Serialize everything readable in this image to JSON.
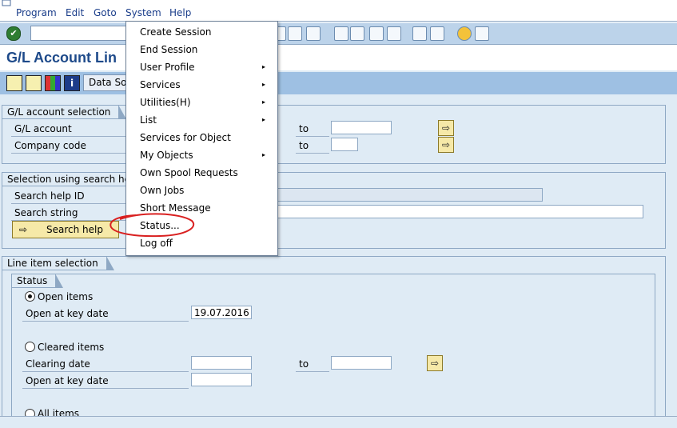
{
  "menubar": {
    "items": [
      "Program",
      "Edit",
      "Goto",
      "System",
      "Help"
    ]
  },
  "title": "G/L Account Lin",
  "app_toolbar": {
    "data_source_label": "Data Sou"
  },
  "gl_account_selection": {
    "heading": "G/L account selection",
    "gl_account_label": "G/L account",
    "company_code_label": "Company code",
    "to_label": "to"
  },
  "search_help_selection": {
    "heading": "Selection using search help",
    "search_help_id_label": "Search help ID",
    "search_string_label": "Search string",
    "search_help_button": "Search help"
  },
  "line_item_selection": {
    "heading": "Line item selection",
    "status_heading": "Status",
    "open_items_label": "Open items",
    "open_key_date_label": "Open at key date",
    "open_key_date_value": "19.07.2016",
    "cleared_items_label": "Cleared items",
    "clearing_date_label": "Clearing date",
    "to_label": "to",
    "cleared_open_key_date_label": "Open at key date",
    "all_items_label": "All items"
  },
  "system_menu": {
    "items": [
      {
        "label": "Create Session",
        "submenu": false
      },
      {
        "label": "End Session",
        "submenu": false
      },
      {
        "label": "User Profile",
        "submenu": true
      },
      {
        "label": "Services",
        "submenu": true
      },
      {
        "label": "Utilities(H)",
        "submenu": true
      },
      {
        "label": "List",
        "submenu": true
      },
      {
        "label": "Services for Object",
        "submenu": false
      },
      {
        "label": "My Objects",
        "submenu": true
      },
      {
        "label": "Own Spool Requests",
        "submenu": false
      },
      {
        "label": "Own Jobs",
        "submenu": false
      },
      {
        "label": "Short Message",
        "submenu": false
      },
      {
        "label": "Status...",
        "submenu": false
      },
      {
        "label": "Log off",
        "submenu": false
      }
    ],
    "submenu_arrow": "▸"
  },
  "colors": {
    "menu_text": "#1a3d8a",
    "highlight_circle": "#d92020",
    "title": "#1e4a8a"
  }
}
